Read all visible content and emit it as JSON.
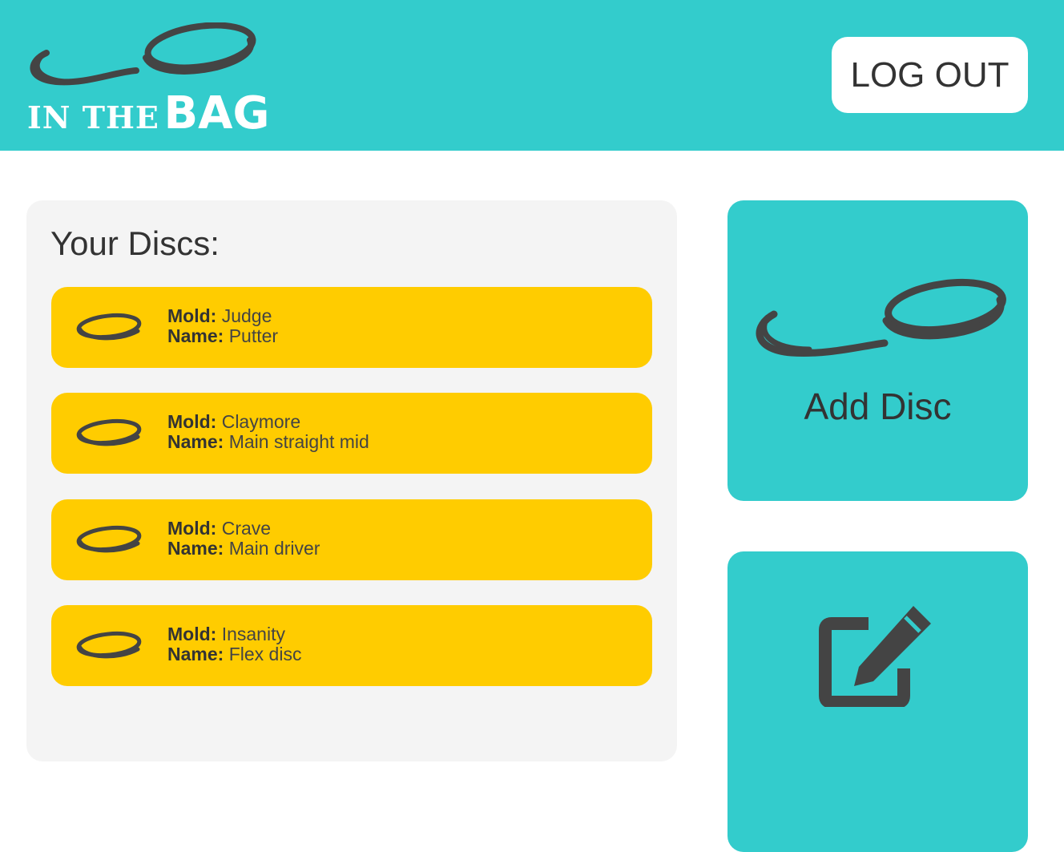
{
  "header": {
    "logo_small_text": "IN THE",
    "logo_big_text": "BAG",
    "logout_label": "LOG OUT"
  },
  "discs_panel": {
    "title": "Your Discs:",
    "mold_label": "Mold:",
    "name_label": "Name:",
    "items": [
      {
        "mold": "Judge",
        "name": "Putter"
      },
      {
        "mold": "Claymore",
        "name": "Main straight mid"
      },
      {
        "mold": "Crave",
        "name": "Main driver"
      },
      {
        "mold": "Insanity",
        "name": "Flex disc"
      }
    ]
  },
  "actions": {
    "add_disc_label": "Add Disc",
    "add_disc_icon": "flying-disc-icon",
    "edit_icon": "edit-icon"
  },
  "colors": {
    "brand_teal": "#33cccc",
    "disc_yellow": "#ffcc00",
    "panel_gray": "#f4f4f4",
    "icon_dark": "#444444"
  }
}
